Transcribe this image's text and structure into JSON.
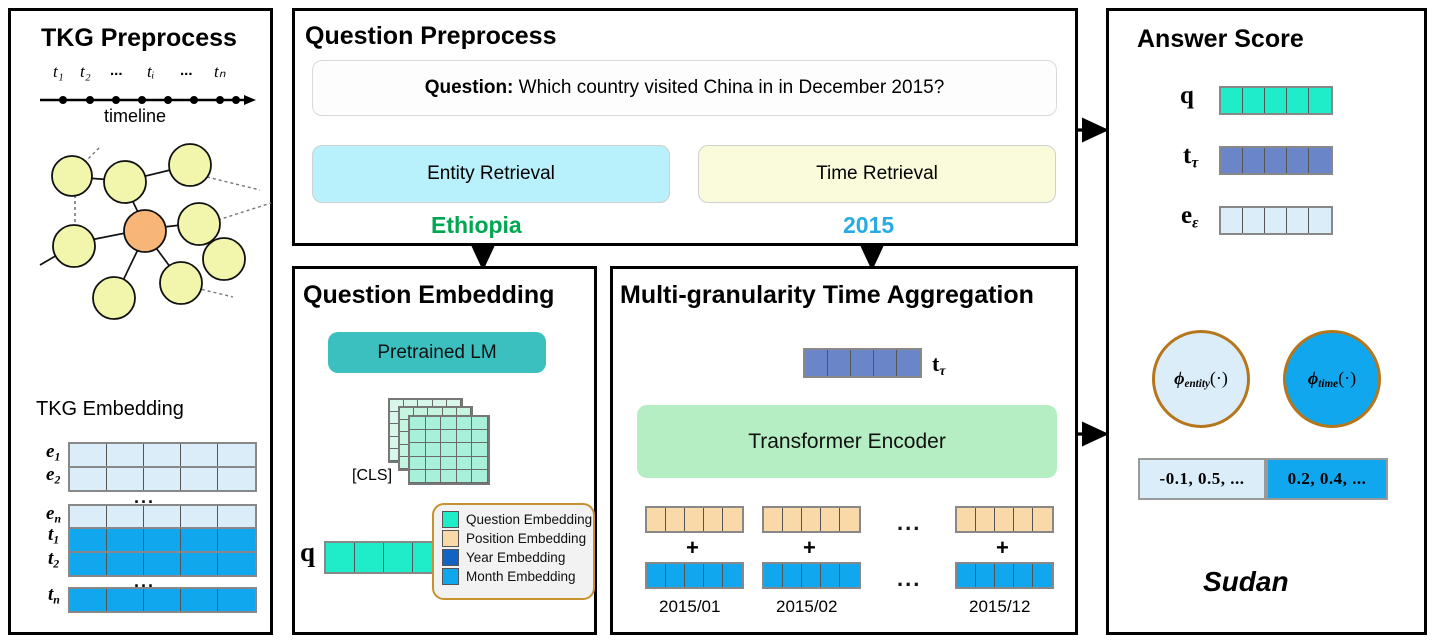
{
  "panels": {
    "tkg_preprocess": {
      "title": "TKG Preprocess"
    },
    "question_preprocess": {
      "title": "Question Preprocess"
    },
    "question_embedding": {
      "title": "Question Embedding"
    },
    "time_aggregation": {
      "title": "Multi-granularity Time Aggregation"
    },
    "answer_score": {
      "title": "Answer Score"
    }
  },
  "tkg_preprocess": {
    "timeline_ticks": [
      "t₁",
      "t₂",
      "...",
      "tᵢ",
      "...",
      "tₙ"
    ],
    "timeline_label": "timeline",
    "embedding_title": "TKG Embedding",
    "entity_rows": [
      "e₁",
      "e₂",
      "eₙ"
    ],
    "time_rows": [
      "t₁",
      "t₂",
      "tₙ"
    ],
    "ellipsis": "...",
    "node_fill": "#f2f5ac",
    "center_node_fill": "#f7b677"
  },
  "question_preprocess": {
    "question_label": "Question:",
    "question_text": " Which country visited China in in December 2015?",
    "entity_retrieval": "Entity Retrieval",
    "time_retrieval": "Time Retrieval",
    "entity_result": "Ethiopia",
    "time_result": "2015",
    "entity_box_color": "#b8f0fb",
    "time_box_color": "#fafbda",
    "entity_result_color": "#00a650",
    "time_result_color": "#29abe2"
  },
  "question_embedding": {
    "pretrained_lm": "Pretrained LM",
    "pretrained_lm_color": "#3cbfbf",
    "cls_label": "[CLS]",
    "q_label": "q",
    "matrix_color": "#a8f0da",
    "q_vector_color": "#1fecc8",
    "legend": [
      {
        "label": "Question Embedding",
        "color": "#1fecc8"
      },
      {
        "label": "Position Embedding",
        "color": "#fad9a8"
      },
      {
        "label": "Year Embedding",
        "color": "#1164c4"
      },
      {
        "label": "Month Embedding",
        "color": "#11a7ee"
      }
    ]
  },
  "time_aggregation": {
    "t_tau_label": "t",
    "t_tau_sub": "τ",
    "encoder_label": "Transformer Encoder",
    "encoder_color": "#b5eec2",
    "t_tau_color": "#6a86c8",
    "position_color": "#fad9a8",
    "month_color": "#11a7ee",
    "plus": "+",
    "ellipsis": "...",
    "time_labels": [
      "2015/01",
      "2015/02",
      "2015/12"
    ]
  },
  "answer_score": {
    "vectors": [
      {
        "name": "q",
        "sub": "",
        "color": "#1fecc8"
      },
      {
        "name": "t",
        "sub": "τ",
        "color": "#6a86c8"
      },
      {
        "name": "e",
        "sub": "ε",
        "color": "#dcedfa"
      }
    ],
    "phi_entity": "ϕ",
    "phi_entity_sub": "entity",
    "phi_time": "ϕ",
    "phi_time_sub": "time",
    "phi_arg": "(·)",
    "phi_entity_color": "#dcedfa",
    "phi_time_color": "#11a7ee",
    "score_left": "-0.1,  0.5,  ...",
    "score_right": "0.2,  0.4,  ...",
    "score_left_color": "#dcedfa",
    "score_right_color": "#11a7ee",
    "answer": "Sudan"
  },
  "colors": {
    "arrow_orange": "#f5a623",
    "arrow_black": "#000000",
    "panel_border": "#000000"
  }
}
